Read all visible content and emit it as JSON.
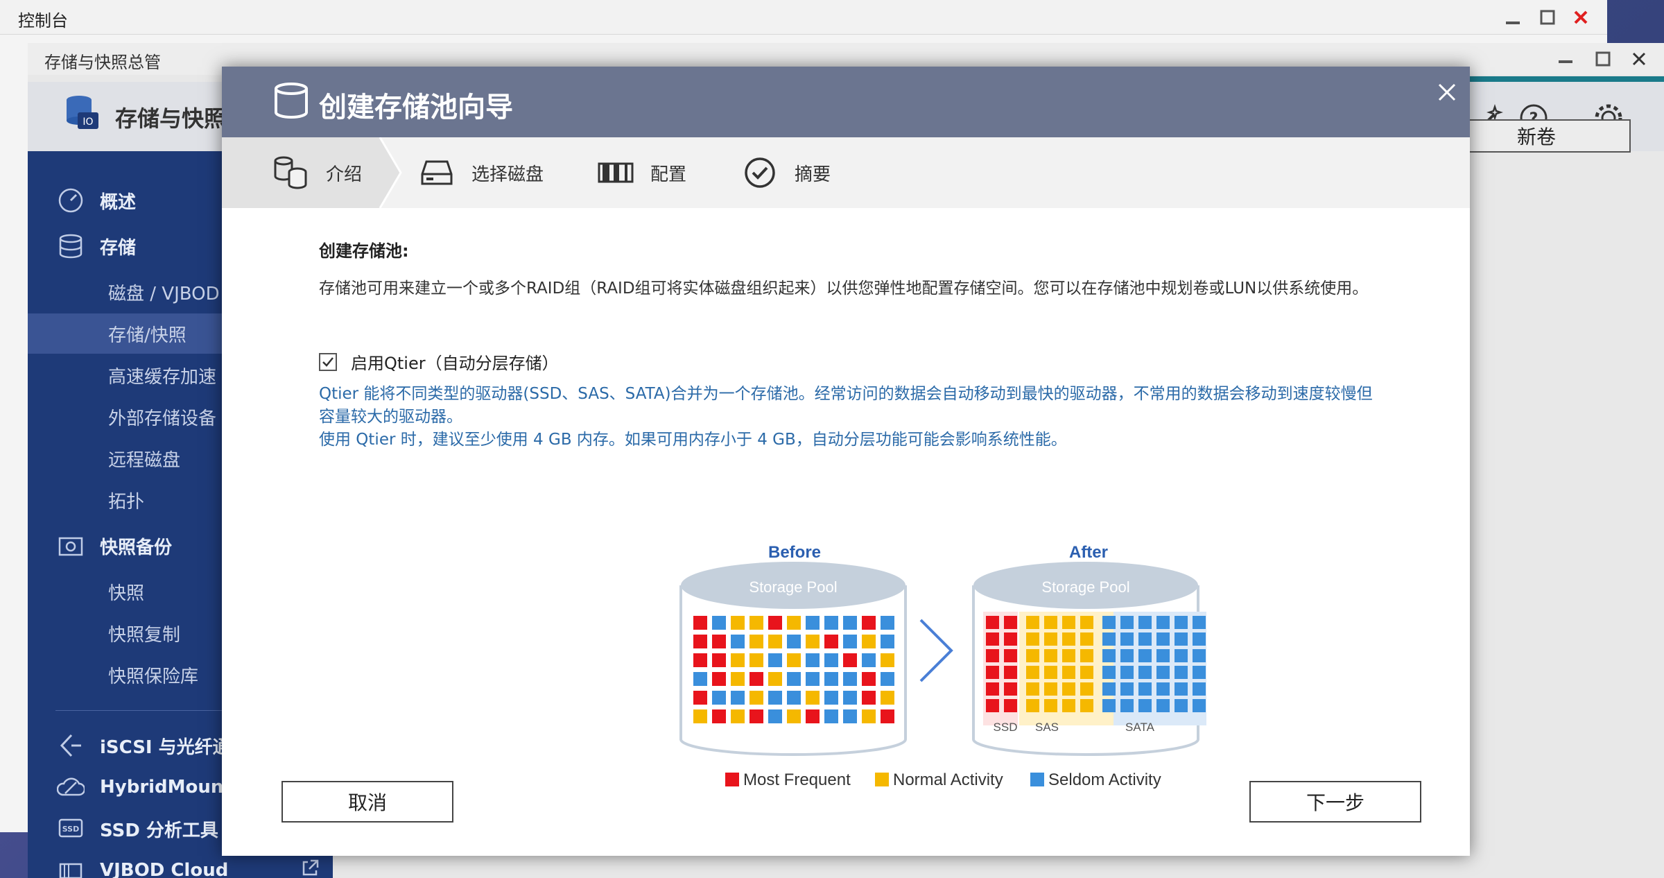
{
  "control_panel": {
    "title": "控制台"
  },
  "storage_manager": {
    "window_title": "存储与快照总管",
    "header_title": "存储与快照总管",
    "new_volume_label": "新卷"
  },
  "sidebar": {
    "items": [
      {
        "label": "概述",
        "level": "top",
        "icon": "gauge-icon"
      },
      {
        "label": "存储",
        "level": "top",
        "icon": "database-icon"
      },
      {
        "label": "磁盘 / VJBOD",
        "level": "sub"
      },
      {
        "label": "存储/快照",
        "level": "sub",
        "active": true
      },
      {
        "label": "高速缓存加速",
        "level": "sub"
      },
      {
        "label": "外部存储设备",
        "level": "sub"
      },
      {
        "label": "远程磁盘",
        "level": "sub"
      },
      {
        "label": "拓扑",
        "level": "sub"
      },
      {
        "label": "快照备份",
        "level": "top",
        "icon": "camera-icon"
      },
      {
        "label": "快照",
        "level": "sub"
      },
      {
        "label": "快照复制",
        "level": "sub"
      },
      {
        "label": "快照保险库",
        "level": "sub"
      },
      {
        "label": "iSCSI 与光纤通道",
        "level": "top",
        "icon": "iscsi-icon"
      },
      {
        "label": "HybridMount",
        "level": "top",
        "icon": "cloud-mount-icon"
      },
      {
        "label": "SSD 分析工具",
        "level": "top",
        "icon": "ssd-icon"
      },
      {
        "label": "VJBOD Cloud",
        "level": "top",
        "icon": "vjbod-cloud-icon"
      }
    ]
  },
  "modal": {
    "title": "创建存储池向导",
    "steps": [
      {
        "label": "介绍",
        "icon": "intro-icon"
      },
      {
        "label": "选择磁盘",
        "icon": "disk-icon"
      },
      {
        "label": "配置",
        "icon": "config-icon"
      },
      {
        "label": "摘要",
        "icon": "check-circle-icon"
      }
    ],
    "section_title": "创建存储池:",
    "description": "存储池可用来建立一个或多个RAID组（RAID组可将实体磁盘组织起来）以供您弹性地配置存储空间。您可以在存储池中规划卷或LUN以供系统使用。",
    "qtier_checkbox_label": "启用Qtier（自动分层存储）",
    "qtier_checked": true,
    "qtier_info_1": "Qtier 能将不同类型的驱动器(SSD、SAS、SATA)合并为一个存储池。经常访问的数据会自动移动到最快的驱动器，不常用的数据会移动到速度较慢但容量较大的驱动器。",
    "qtier_info_2": "使用 Qtier 时，建议至少使用 4 GB 内存。如果可用内存小于 4 GB，自动分层功能可能会影响系统性能。",
    "cancel_label": "取消",
    "next_label": "下一步"
  },
  "diagram": {
    "before_label": "Before",
    "after_label": "After",
    "pool_label": "Storage Pool",
    "tier_labels": [
      "SSD",
      "SAS",
      "SATA"
    ],
    "legend": [
      {
        "label": "Most Frequent",
        "color": "#e8141c"
      },
      {
        "label": "Normal Activity",
        "color": "#f5b800"
      },
      {
        "label": "Seldom Activity",
        "color": "#3a8fdc"
      }
    ],
    "colors": {
      "pool_top": "#c5d0dc",
      "pool_label": "#ffffff",
      "arrow": "#4a7fd6",
      "heading": "#2b5fb0"
    }
  }
}
